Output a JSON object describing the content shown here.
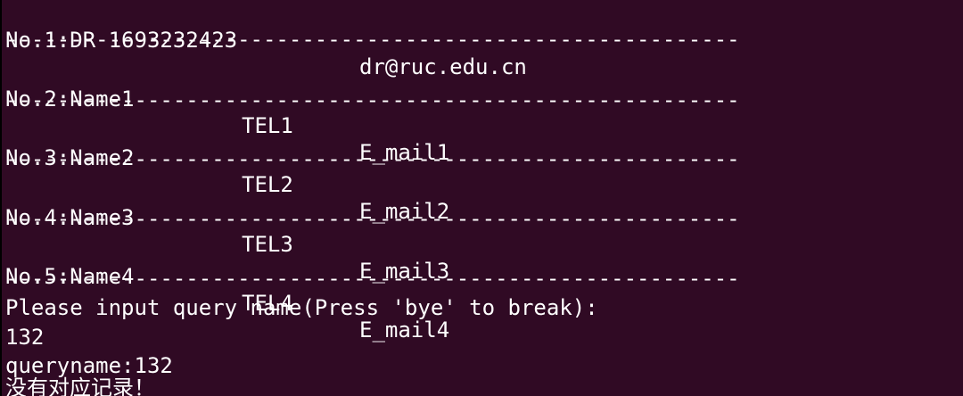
{
  "terminal": {
    "background": "#300a24",
    "foreground": "#ffffff",
    "records": [
      {
        "no_name": "No.1:DR 1693232423",
        "tel": "",
        "email": "dr@ruc.edu.cn"
      },
      {
        "no_name": "No.2:Name1",
        "tel": "TEL1",
        "email": "E_mail1"
      },
      {
        "no_name": "No.3:Name2",
        "tel": "TEL2",
        "email": "E_mail2"
      },
      {
        "no_name": "No.4:Name3",
        "tel": "TEL3",
        "email": "E_mail3"
      },
      {
        "no_name": "No.5:Name4",
        "tel": "TEL4",
        "email": "E_mail4"
      }
    ],
    "separator": "---------------------------------------------------------",
    "prompt": "Please input query name(Press 'bye' to break):",
    "user_input": "132",
    "query_echo": "queryname:132",
    "result_message": "没有对应记录！"
  }
}
